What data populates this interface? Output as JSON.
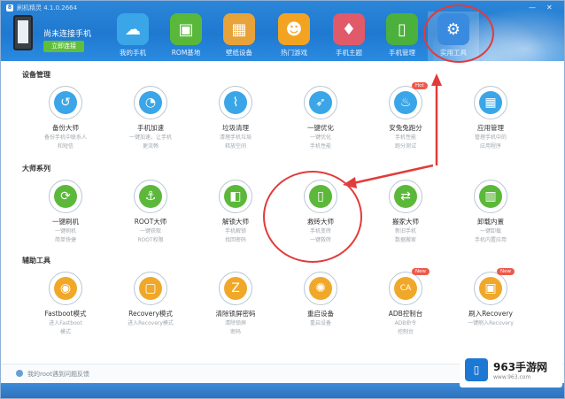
{
  "window": {
    "title": "刷机精灵 4.1.0.2664",
    "min": "—",
    "close": "✕"
  },
  "device": {
    "connect_text": "尚未连接手机",
    "connect_button": "立即连接"
  },
  "nav": [
    {
      "label": "我的手机",
      "icon": "cloud-icon",
      "color": "#3aa6e8"
    },
    {
      "label": "ROM基地",
      "icon": "rom-bag-icon",
      "color": "#59b83a"
    },
    {
      "label": "壁纸设备",
      "icon": "wallpaper-icon",
      "color": "#e8a23a"
    },
    {
      "label": "热门游戏",
      "icon": "game-icon",
      "color": "#f3a322"
    },
    {
      "label": "手机主题",
      "icon": "theme-shirt-icon",
      "color": "#e05a6a"
    },
    {
      "label": "手机管理",
      "icon": "phone-manage-icon",
      "color": "#4bb03c"
    },
    {
      "label": "实用工具",
      "icon": "toolbox-icon",
      "color": "#3a8be0"
    }
  ],
  "sections": [
    {
      "title": "设备管理",
      "tools": [
        {
          "name": "备份大师",
          "desc": [
            "备份手机中联系人",
            "和短信"
          ],
          "icon": "backup-icon",
          "color": "#3aa6e8",
          "badge": ""
        },
        {
          "name": "手机加速",
          "desc": [
            "一键加速，让手机",
            "更流畅"
          ],
          "icon": "speedometer-icon",
          "color": "#3aa6e8",
          "badge": ""
        },
        {
          "name": "垃圾清理",
          "desc": [
            "清理手机垃圾",
            "释放空间"
          ],
          "icon": "broom-icon",
          "color": "#3aa6e8",
          "badge": ""
        },
        {
          "name": "一键优化",
          "desc": [
            "一键优化",
            "手机性能"
          ],
          "icon": "rocket-icon",
          "color": "#3aa6e8",
          "badge": ""
        },
        {
          "name": "安兔兔跑分",
          "desc": [
            "手机性能",
            "跑分测试"
          ],
          "icon": "benchmark-icon",
          "color": "#3aa6e8",
          "badge": "Hot"
        },
        {
          "name": "应用管理",
          "desc": [
            "管理手机中的",
            "应用程序"
          ],
          "icon": "apps-grid-icon",
          "color": "#3aa6e8",
          "badge": ""
        }
      ]
    },
    {
      "title": "大师系列",
      "tools": [
        {
          "name": "一键刷机",
          "desc": [
            "一键刷机",
            "简单快捷"
          ],
          "icon": "refresh-icon",
          "color": "#5cb83a",
          "badge": ""
        },
        {
          "name": "ROOT大师",
          "desc": [
            "一键获取",
            "ROOT权限"
          ],
          "icon": "anchor-icon",
          "color": "#5cb83a",
          "badge": ""
        },
        {
          "name": "解锁大师",
          "desc": [
            "手机解锁",
            "找回密码"
          ],
          "icon": "unlock-icon",
          "color": "#5cb83a",
          "badge": ""
        },
        {
          "name": "救砖大师",
          "desc": [
            "手机变砖",
            "一键救砖"
          ],
          "icon": "rescue-phone-icon",
          "color": "#5cb83a",
          "badge": ""
        },
        {
          "name": "搬家大师",
          "desc": [
            "新旧手机",
            "数据搬家"
          ],
          "icon": "transfer-icon",
          "color": "#5cb83a",
          "badge": ""
        },
        {
          "name": "卸载内置",
          "desc": [
            "一键卸载",
            "手机内置应用"
          ],
          "icon": "trash-icon",
          "color": "#5cb83a",
          "badge": ""
        }
      ]
    },
    {
      "title": "辅助工具",
      "tools": [
        {
          "name": "Fastboot模式",
          "desc": [
            "进入Fastboot",
            "模式"
          ],
          "icon": "fastboot-icon",
          "color": "#f0a82a",
          "badge": ""
        },
        {
          "name": "Recovery模式",
          "desc": [
            "进入Recovery模式"
          ],
          "icon": "recovery-icon",
          "color": "#f0a82a",
          "badge": ""
        },
        {
          "name": "清除锁屏密码",
          "desc": [
            "清除锁屏",
            "密码"
          ],
          "icon": "clear-lock-icon",
          "color": "#f0a82a",
          "badge": ""
        },
        {
          "name": "重启设备",
          "desc": [
            "重启设备"
          ],
          "icon": "restart-gear-icon",
          "color": "#f0a82a",
          "badge": ""
        },
        {
          "name": "ADB控制台",
          "desc": [
            "ADB命令",
            "控制台"
          ],
          "icon": "ca-icon",
          "color": "#f0a82a",
          "badge": "New"
        },
        {
          "name": "刷入Recovery",
          "desc": [
            "一键刷入Recovery"
          ],
          "icon": "flash-recovery-icon",
          "color": "#f0a82a",
          "badge": "New"
        }
      ]
    }
  ],
  "status": {
    "text": "我的root遇到问题反馈"
  },
  "watermark": {
    "name": "963手游网",
    "url": "www.963.com"
  }
}
